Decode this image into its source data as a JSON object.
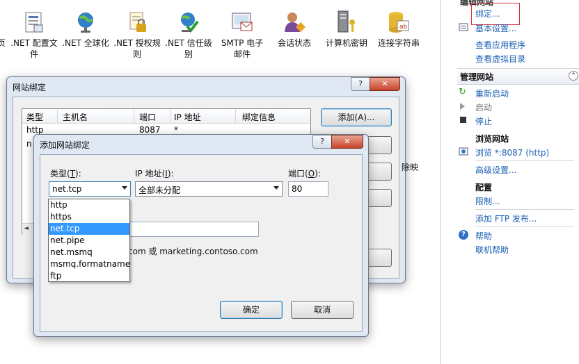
{
  "features": [
    {
      "label": "页",
      "icon": "page-icon"
    },
    {
      "label": ".NET 配置文\n件",
      "icon": "net-profile-icon"
    },
    {
      "label": ".NET 全球化",
      "icon": "globe-icon"
    },
    {
      "label": ".NET 授权规\n则",
      "icon": "lock-document-icon"
    },
    {
      "label": ".NET 信任级\n别",
      "icon": "trust-globe-icon"
    },
    {
      "label": "SMTP 电子\n邮件",
      "icon": "smtp-mail-icon"
    },
    {
      "label": "会话状态",
      "icon": "session-state-icon"
    },
    {
      "label": "计算机密钥",
      "icon": "machine-key-icon"
    },
    {
      "label": "连接字符串",
      "icon": "connection-strings-icon"
    }
  ],
  "actions": {
    "top_partial": "编辑网站",
    "bindings": "绑定...",
    "basic_settings": "基本设置...",
    "view_apps": "查看应用程序",
    "view_vdirs": "查看虚拟目录",
    "manage_site_head": "管理网站",
    "restart": "重新启动",
    "start": "启动",
    "stop": "停止",
    "browse_head": "浏览网站",
    "browse_link": "浏览 *:8087 (http)",
    "advanced": "高级设置...",
    "config_head": "配置",
    "limits": "限制...",
    "add_ftp": "添加 FTP 发布...",
    "help": "帮助",
    "online_help": "联机帮助",
    "highlight_color": "#e0343a"
  },
  "site_bindings": {
    "title": "网站绑定",
    "help_btn": "?",
    "close_btn": "✕",
    "columns": [
      "类型",
      "主机名",
      "端口",
      "IP 地址",
      "绑定信息"
    ],
    "row1": {
      "type": "http",
      "port": "8087",
      "ip": "*"
    },
    "row2_partial": "n",
    "add_button": "添加(A)...",
    "partial_right_text": "除映"
  },
  "add_binding": {
    "title": "添加网站绑定",
    "help_btn": "?",
    "close_btn": "✕",
    "type_label_pre": "类型(",
    "type_label_key": "T",
    "type_label_post": "):",
    "type_value": "net.tcp",
    "ip_label_pre": "IP 地址(",
    "ip_label_key": "I",
    "ip_label_post": "):",
    "ip_value": "全部未分配",
    "port_label_pre": "端口(",
    "port_label_key": "O",
    "port_label_post": "):",
    "port_value": "80",
    "example_suffix": "com 或 marketing.contoso.com",
    "ok": "确定",
    "cancel": "取消",
    "type_options": [
      "http",
      "https",
      "net.tcp",
      "net.pipe",
      "net.msmq",
      "msmq.formatname",
      "ftp"
    ],
    "selected_option": "net.tcp",
    "selection_color": "#3399ff"
  }
}
